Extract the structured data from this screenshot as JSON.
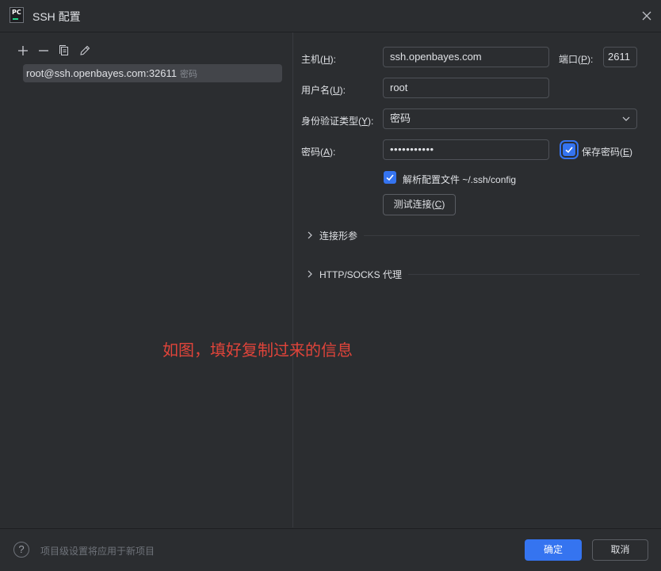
{
  "window": {
    "title": "SSH 配置"
  },
  "toolbar": {
    "add_icon": "plus-icon",
    "remove_icon": "minus-icon",
    "copy_icon": "copy-icon",
    "edit_icon": "pencil-icon"
  },
  "hosts": [
    {
      "name": "root@ssh.openbayes.com:32611",
      "auth": "密码"
    }
  ],
  "annotation": "如图，填好复制过来的信息",
  "form": {
    "host_label_pre": "主机(",
    "host_label_key": "H",
    "host_label_post": "):",
    "host_value": "ssh.openbayes.com",
    "port_label_pre": "端口(",
    "port_label_key": "P",
    "port_label_post": "):",
    "port_value": "2611",
    "user_label_pre": "用户名(",
    "user_label_key": "U",
    "user_label_post": "):",
    "user_value": "root",
    "auth_label_pre": "身份验证类型(",
    "auth_label_key": "Y",
    "auth_label_post": "):",
    "auth_value": "密码",
    "password_label_pre": "密码(",
    "password_label_key": "A",
    "password_label_post": "):",
    "password_value": "•••••••••••",
    "save_password_pre": "保存密码(",
    "save_password_key": "E",
    "save_password_post": ")",
    "save_password_checked": true,
    "parse_config_label": "解析配置文件 ~/.ssh/config",
    "parse_config_checked": true,
    "test_pre": "测试连接(",
    "test_key": "C",
    "test_post": ")"
  },
  "sections": {
    "connection_params": "连接形参",
    "proxy": "HTTP/SOCKS 代理"
  },
  "footer": {
    "help": "?",
    "note": "项目级设置将应用于新项目",
    "ok": "确定",
    "cancel": "取消"
  },
  "colors": {
    "accent": "#3574f0",
    "background": "#2b2d30",
    "annotation": "#e0443a"
  }
}
